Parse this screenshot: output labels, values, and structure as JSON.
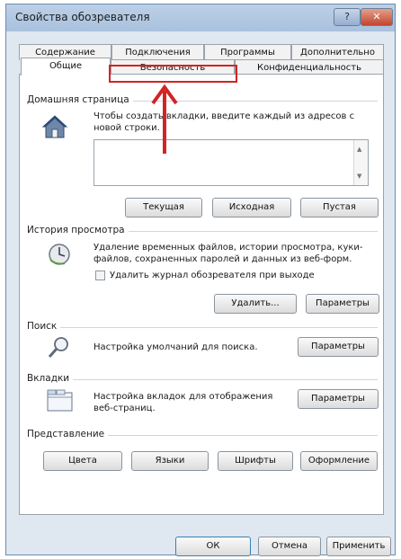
{
  "window": {
    "title": "Свойства обозревателя",
    "help_glyph": "?",
    "close_glyph": "✕"
  },
  "tabs": {
    "row1": [
      "Содержание",
      "Подключения",
      "Программы",
      "Дополнительно"
    ],
    "row2": [
      "Общие",
      "Безопасность",
      "Конфиденциальность"
    ],
    "active": "Общие",
    "highlighted": "Безопасность"
  },
  "home_page": {
    "title": "Домашняя страница",
    "description": "Чтобы создать вкладки, введите каждый из адресов с новой строки.",
    "textarea_value": "",
    "buttons": [
      "Текущая",
      "Исходная",
      "Пустая"
    ]
  },
  "history": {
    "title": "История просмотра",
    "description": "Удаление временных файлов, истории просмотра, куки-файлов, сохраненных паролей и данных из веб-форм.",
    "checkbox_label": "Удалить журнал обозревателя при выходе",
    "checkbox_checked": false,
    "buttons": [
      "Удалить...",
      "Параметры"
    ]
  },
  "search": {
    "title": "Поиск",
    "description": "Настройка умолчаний для поиска.",
    "button": "Параметры"
  },
  "tabs_group": {
    "title": "Вкладки",
    "description": "Настройка вкладок для отображения веб-страниц.",
    "button": "Параметры"
  },
  "appearance": {
    "title": "Представление",
    "buttons": [
      "Цвета",
      "Языки",
      "Шрифты",
      "Оформление"
    ]
  },
  "footer": {
    "buttons": [
      "ОК",
      "Отмена",
      "Применить"
    ]
  },
  "colors": {
    "annotation_red": "#d22424"
  }
}
